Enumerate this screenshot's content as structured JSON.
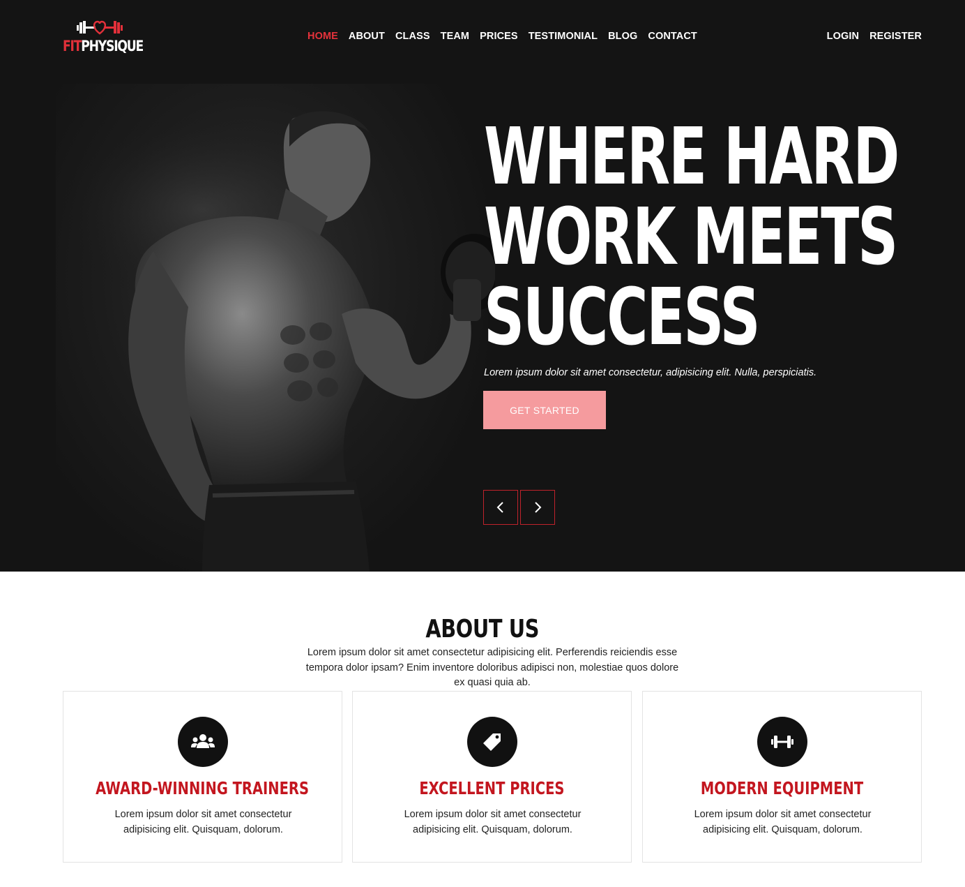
{
  "brand": {
    "logo_part1": "FIT",
    "logo_part2": "PHYSIQUE",
    "accent_color": "#e5323b",
    "title_red": "#c3161f",
    "button_color": "#f59b9e"
  },
  "nav": {
    "items": [
      {
        "label": "HOME",
        "active": true
      },
      {
        "label": "ABOUT"
      },
      {
        "label": "CLASS"
      },
      {
        "label": "TEAM"
      },
      {
        "label": "PRICES"
      },
      {
        "label": "TESTIMONIAL"
      },
      {
        "label": "BLOG"
      },
      {
        "label": "CONTACT"
      }
    ],
    "login": "LOGIN",
    "register": "REGISTER"
  },
  "hero": {
    "title_line1": "WHERE HARD",
    "title_line2": "WORK MEETS",
    "title_line3": "SUCCESS",
    "subtitle": "Lorem ipsum dolor sit amet consectetur, adipisicing elit. Nulla, perspiciatis.",
    "cta": "GET STARTED",
    "prev_icon": "chevron-left-icon",
    "next_icon": "chevron-right-icon"
  },
  "about": {
    "title": "ABOUT US",
    "text": "Lorem ipsum dolor sit amet consectetur adipisicing elit. Perferendis reiciendis esse tempora dolor ipsam? Enim inventore doloribus adipisci non, molestiae quos dolore ex quasi quia ab.",
    "cards": [
      {
        "icon": "users-icon",
        "title": "AWARD-WINNING TRAINERS",
        "text": "Lorem ipsum dolor sit amet consectetur adipisicing elit. Quisquam, dolorum."
      },
      {
        "icon": "price-tag-icon",
        "title": "EXCELLENT PRICES",
        "text": "Lorem ipsum dolor sit amet consectetur adipisicing elit. Quisquam, dolorum."
      },
      {
        "icon": "dumbbell-icon",
        "title": "MODERN EQUIPMENT",
        "text": "Lorem ipsum dolor sit amet consectetur adipisicing elit. Quisquam, dolorum."
      }
    ]
  }
}
